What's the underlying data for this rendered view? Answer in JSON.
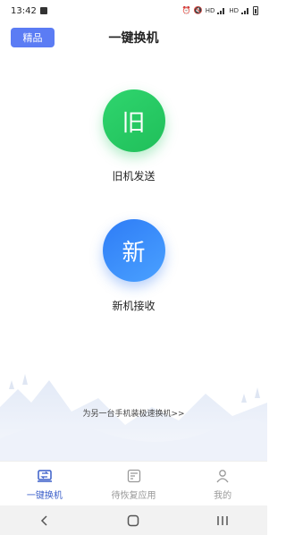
{
  "status_bar": {
    "time": "13:42",
    "right_text": "HD"
  },
  "header": {
    "premium_label": "精品",
    "title": "一键换机"
  },
  "actions": [
    {
      "glyph": "旧",
      "label": "旧机发送",
      "color": "#22c55e"
    },
    {
      "glyph": "新",
      "label": "新机接收",
      "color": "#3b82f6"
    }
  ],
  "promo_text": "为另一台手机装极速换机>>",
  "tabs": [
    {
      "label": "一键换机",
      "icon": "phone-transfer-icon",
      "active": true
    },
    {
      "label": "待恢复应用",
      "icon": "app-restore-icon",
      "active": false
    },
    {
      "label": "我的",
      "icon": "profile-icon",
      "active": false
    }
  ],
  "colors": {
    "accent": "#3a5ec9",
    "premium": "#5b7cf4"
  }
}
